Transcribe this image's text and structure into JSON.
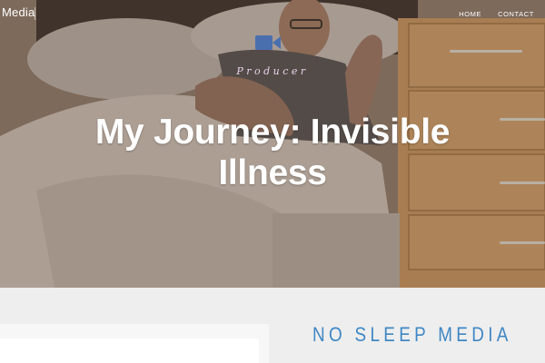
{
  "site": {
    "brand": "Media"
  },
  "nav": {
    "items": [
      {
        "label": "HOME"
      },
      {
        "label": "CONTACT"
      }
    ]
  },
  "hero": {
    "role": "Producer",
    "title": "My Journey: Invisible Illness",
    "icon": "video-camera-icon",
    "background": "photo of a man lying in bed beside a wooden bedside cabinet"
  },
  "sidebar": {
    "title": "NO SLEEP MEDIA"
  },
  "colors": {
    "accent": "#3f87c4",
    "role_text": "#ead3ee",
    "camera_icon": "#4a6fae",
    "page_bg": "#eeeeee"
  }
}
